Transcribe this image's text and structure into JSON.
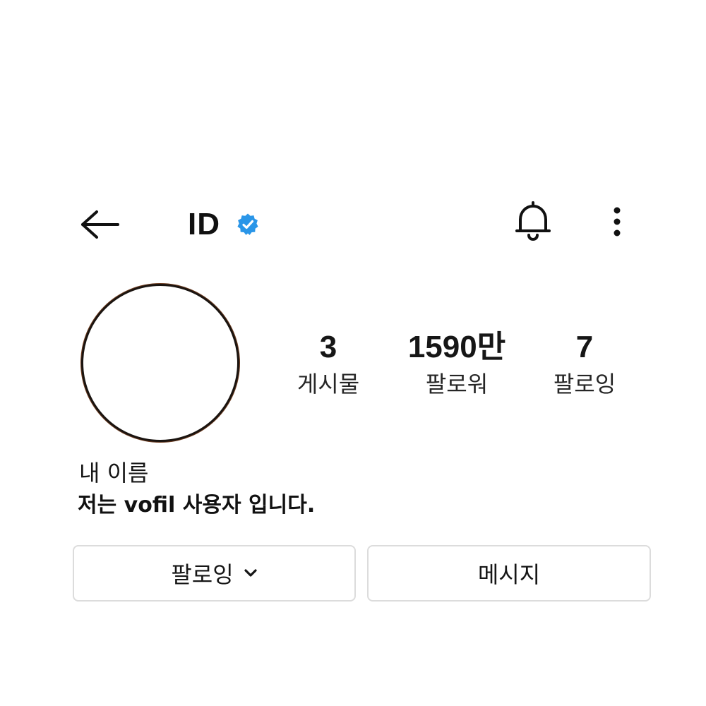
{
  "header": {
    "username": "ID",
    "verified": true,
    "verified_badge_color": "#2a96e8",
    "back_icon": "arrow-left-icon",
    "notification_icon": "bell-icon",
    "more_icon": "more-vertical-icon"
  },
  "stats": {
    "posts": {
      "count": "3",
      "label": "게시물"
    },
    "followers": {
      "count": "1590만",
      "label": "팔로워"
    },
    "following": {
      "count": "7",
      "label": "팔로잉"
    }
  },
  "profile": {
    "display_name": "내 이름",
    "bio": "저는 vofil 사용자 입니다."
  },
  "actions": {
    "follow_label": "팔로잉",
    "follow_icon": "chevron-down-icon",
    "message_label": "메시지"
  }
}
